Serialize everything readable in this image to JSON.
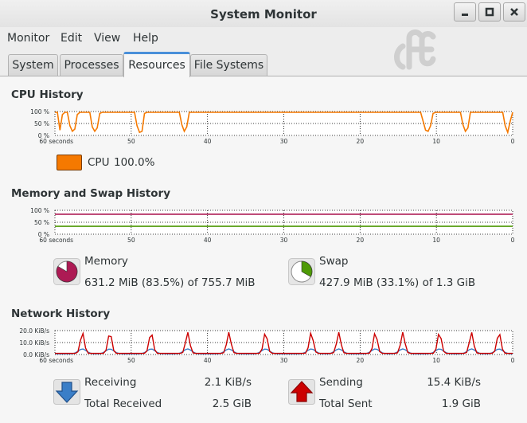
{
  "window": {
    "title": "System Monitor"
  },
  "menu": [
    "Monitor",
    "Edit",
    "View",
    "Help"
  ],
  "tabs": [
    {
      "label": "System",
      "active": false
    },
    {
      "label": "Processes",
      "active": false
    },
    {
      "label": "Resources",
      "active": true
    },
    {
      "label": "File Systems",
      "active": false
    }
  ],
  "colors": {
    "cpu": "#f57900",
    "memory": "#ad1a54",
    "swap": "#4e9a06",
    "receiving": "#3a7ec7",
    "sending": "#cc0000",
    "tab_accent": "#4a90d9"
  },
  "icons": {
    "minimize": "minimize-icon",
    "maximize": "maximize-icon",
    "close": "close-icon",
    "receiving": "down-arrow-icon",
    "sending": "up-arrow-icon"
  },
  "x_axis": {
    "labels": [
      "60 seconds",
      "50",
      "40",
      "30",
      "20",
      "10",
      "0"
    ]
  },
  "cpu": {
    "title": "CPU History",
    "y_labels": [
      "100 %",
      "50 %",
      "0 %"
    ],
    "legend_label": "CPU",
    "legend_value": "100.0%",
    "series": [
      100,
      100,
      20,
      90,
      100,
      100,
      40,
      15,
      25,
      90,
      100,
      100,
      100,
      100,
      100,
      35,
      15,
      30,
      95,
      100,
      100,
      100,
      100,
      100,
      100,
      100,
      100,
      100,
      100,
      100,
      100,
      100,
      100,
      40,
      10,
      15,
      95,
      100,
      100,
      100,
      100,
      100,
      100,
      100,
      100,
      100,
      100,
      100,
      100,
      100,
      100,
      45,
      15,
      35,
      100,
      100,
      100,
      100,
      100,
      100,
      100,
      100,
      100,
      100,
      100,
      100,
      100,
      100,
      100,
      100,
      100,
      100,
      100,
      100,
      100,
      100,
      100,
      100,
      100,
      100,
      100,
      100,
      100,
      100,
      100,
      100,
      100,
      100,
      100,
      100,
      100,
      100,
      100,
      100,
      100,
      100,
      100,
      100,
      100,
      100,
      100,
      100,
      100,
      100,
      100,
      100,
      100,
      100,
      100,
      100,
      100,
      100,
      100,
      100,
      100,
      100,
      100,
      100,
      100,
      100,
      100,
      100,
      100,
      100,
      100,
      100,
      100,
      100,
      100,
      100,
      100,
      100,
      100,
      100,
      100,
      100,
      100,
      100,
      100,
      100,
      100,
      100,
      100,
      100,
      100,
      100,
      100,
      100,
      60,
      20,
      15,
      40,
      95,
      100,
      100,
      100,
      100,
      100,
      100,
      100,
      100,
      100,
      100,
      100,
      45,
      15,
      30,
      100,
      100,
      100,
      100,
      100,
      100,
      100,
      100,
      100,
      100,
      100,
      100,
      100,
      100,
      40,
      10,
      60,
      100
    ]
  },
  "memory": {
    "title": "Memory and Swap History",
    "y_labels": [
      "100 %",
      "50 %",
      "0 %"
    ],
    "memory_label": "Memory",
    "memory_value": "631.2 MiB (83.5%) of 755.7 MiB",
    "memory_percent": 83.5,
    "swap_label": "Swap",
    "swap_value": "427.9 MiB (33.1%) of 1.3 GiB",
    "swap_percent": 33.1
  },
  "network": {
    "title": "Network History",
    "y_labels": [
      "20.0 KiB/s",
      "10.0 KiB/s",
      "0.0 KiB/s"
    ],
    "receiving_label": "Receiving",
    "receiving_value": "2.1 KiB/s",
    "total_received_label": "Total Received",
    "total_received_value": "2.5 GiB",
    "sending_label": "Sending",
    "sending_value": "15.4 KiB/s",
    "total_sent_label": "Total Sent",
    "total_sent_value": "1.9 GiB"
  }
}
